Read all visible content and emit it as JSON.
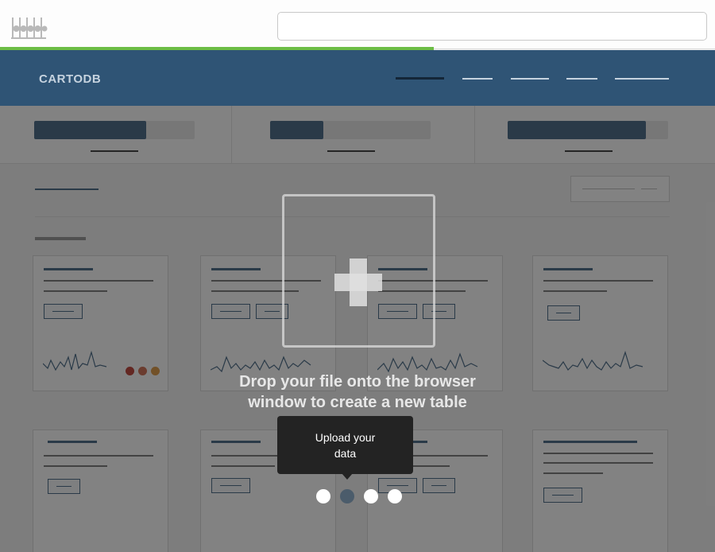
{
  "header": {
    "brand": "CARTODB"
  },
  "drop_zone": {
    "line1": "Drop your file onto the browser",
    "line2": "window to create a new table"
  },
  "tooltip": {
    "line1": "Upload your",
    "line2": "data"
  },
  "pager": {
    "count": 4,
    "active_index": 1
  },
  "stats": [
    {
      "fill_fraction": 0.7
    },
    {
      "fill_fraction": 0.33
    },
    {
      "fill_fraction": 0.86
    }
  ],
  "card_dot_colors": [
    "#b5281c",
    "#c85a3a",
    "#d98b2a"
  ],
  "colors": {
    "header_bg": "#2f5475",
    "progress": "#6cbd45",
    "overlay": "rgba(40,40,40,0.58)"
  },
  "icons": {
    "browser_logo": "app-logo-icon",
    "upload": "plus-icon"
  }
}
